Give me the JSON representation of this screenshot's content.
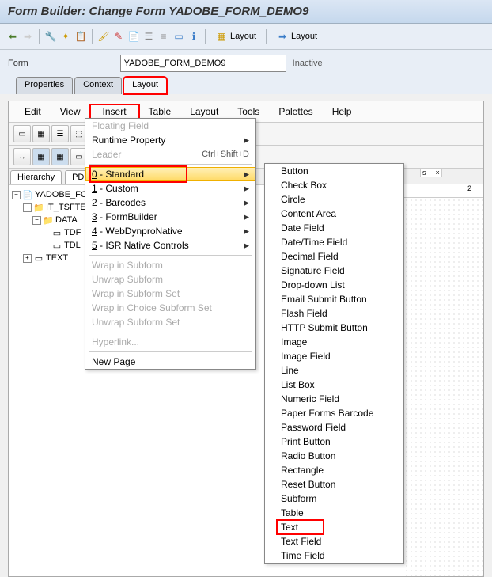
{
  "title": "Form Builder: Change Form YADOBE_FORM_DEMO9",
  "toolbar_layout_btn": "Layout",
  "toolbar_layout_btn2": "Layout",
  "form_label": "Form",
  "form_value": "YADOBE_FORM_DEMO9",
  "status": "Inactive",
  "tabs": {
    "properties": "Properties",
    "context": "Context",
    "layout": "Layout"
  },
  "menubar": {
    "edit": "Edit",
    "view": "View",
    "insert": "Insert",
    "table": "Table",
    "layout": "Layout",
    "tools": "Tools",
    "palettes": "Palettes",
    "help": "Help"
  },
  "insert_menu": {
    "floating_field": "Floating Field",
    "runtime_property": "Runtime Property",
    "leader": "Leader",
    "leader_sc": "Ctrl+Shift+D",
    "standard": "0 - Standard",
    "custom": "1 - Custom",
    "barcodes": "2 - Barcodes",
    "formbuilder": "3 - FormBuilder",
    "webdynpro": "4 - WebDynproNative",
    "isr": "5 - ISR Native Controls",
    "wrap_subform": "Wrap in Subform",
    "unwrap_subform": "Unwrap Subform",
    "wrap_subform_set": "Wrap in Subform Set",
    "wrap_choice": "Wrap in Choice Subform Set",
    "unwrap_subform_set": "Unwrap Subform Set",
    "hyperlink": "Hyperlink...",
    "new_page": "New Page"
  },
  "standard_submenu": [
    "Button",
    "Check Box",
    "Circle",
    "Content Area",
    "Date Field",
    "Date/Time Field",
    "Decimal Field",
    "Signature Field",
    "Drop-down List",
    "Email Submit Button",
    "Flash Field",
    "HTTP Submit Button",
    "Image",
    "Image Field",
    "Line",
    "List Box",
    "Numeric Field",
    "Paper Forms Barcode",
    "Password Field",
    "Print Button",
    "Radio Button",
    "Rectangle",
    "Reset Button",
    "Subform",
    "Table",
    "Text",
    "Text Field",
    "Time Field"
  ],
  "panel_tabs": {
    "hierarchy": "Hierarchy",
    "pdf": "PDF S"
  },
  "tree": {
    "root": "YADOBE_FORM",
    "it": "IT_TSFTEXT",
    "data": "DATA",
    "tdf": "TDF",
    "tdl": "TDL",
    "text": "TEXT"
  },
  "ruler_close": "×",
  "ruler_num": "2",
  "ruler_s": "s"
}
